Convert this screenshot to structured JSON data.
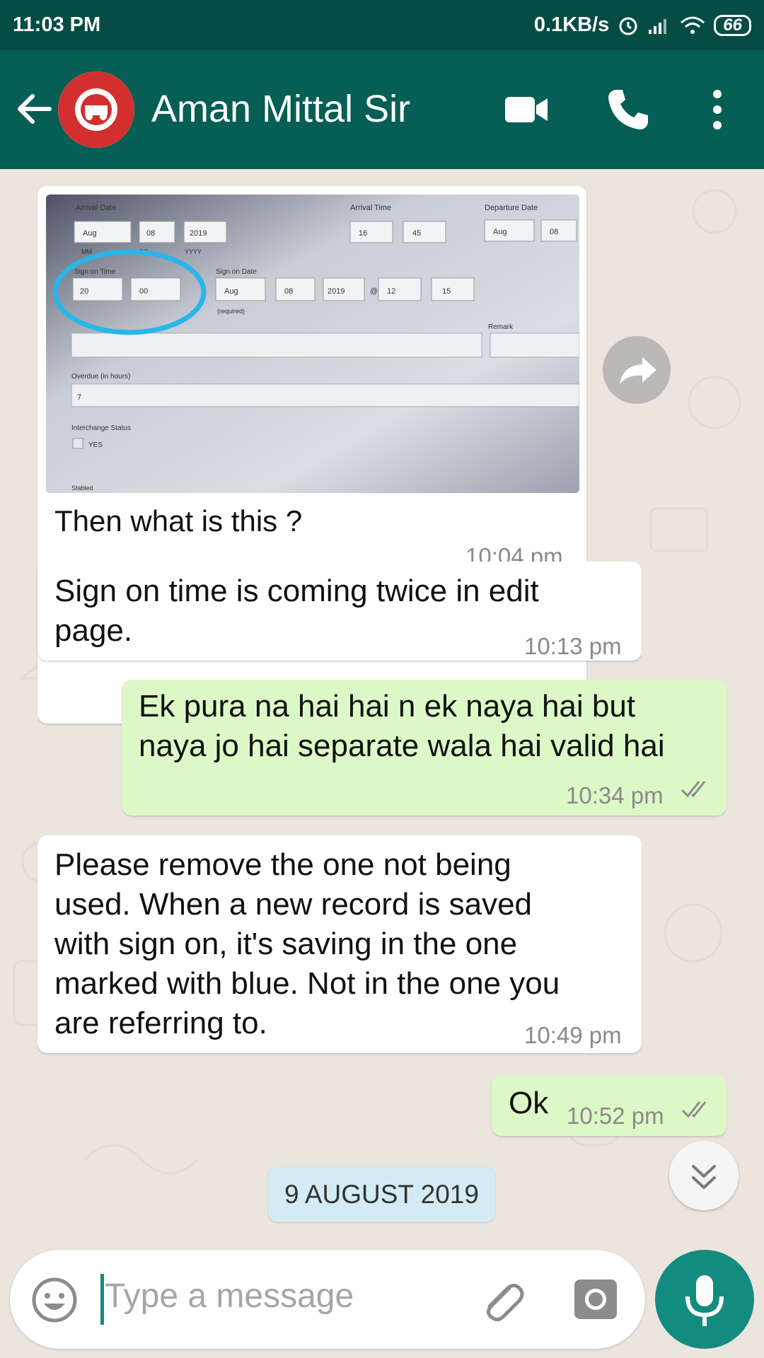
{
  "status_bar": {
    "time": "11:03 PM",
    "net_speed": "0.1KB/s",
    "battery": "66"
  },
  "header": {
    "contact_name": "Aman Mittal Sir",
    "icons": [
      "back-arrow-icon",
      "video-call-icon",
      "phone-icon",
      "more-vert-icon"
    ]
  },
  "messages": [
    {
      "direction": "in",
      "type": "image",
      "caption": "Then what is this ?",
      "time": "10:04 pm"
    },
    {
      "direction": "in",
      "type": "text",
      "lines": [
        "Sign on time is coming twice in edit",
        "page."
      ],
      "time": "10:13 pm"
    },
    {
      "direction": "out",
      "type": "text",
      "lines": [
        "Ek pura na hai hai n ek naya hai but",
        "naya jo hai separate wala hai valid hai"
      ],
      "time": "10:34 pm",
      "status": "read"
    },
    {
      "direction": "in",
      "type": "text",
      "lines": [
        "Please remove the one not being",
        "used. When a new record is saved",
        "with sign on, it's saving in the one",
        "marked with blue. Not in the one you",
        "are referring to."
      ],
      "time": "10:49 pm"
    },
    {
      "direction": "out",
      "type": "text",
      "lines": [
        "Ok"
      ],
      "time": "10:52 pm",
      "status": "read"
    }
  ],
  "screenshot_form": {
    "labels": {
      "arrival_date": "Arrival Date",
      "arrival_time": "Arrival Time",
      "departure_date": "Departure Date",
      "mm": "MM",
      "dd": "DD",
      "yyyy": "YYYY",
      "sign_on_time": "Sign on Time",
      "sign_on_date": "Sign on Date",
      "required": "(required)",
      "remark": "Remark",
      "overdue": "Overdue (in hours)",
      "interchange": "Interchange Status",
      "yes": "YES",
      "stabled": "Stabled"
    },
    "values": {
      "arr_month": "Aug",
      "arr_day": "08",
      "arr_year": "2019",
      "arr_hour": "16",
      "arr_min": "45",
      "dep_month": "Aug",
      "dep_day": "08",
      "sot_hour": "20",
      "sot_min": "00",
      "sod_month": "Aug",
      "sod_day": "08",
      "sod_year": "2019",
      "sod_at": "@",
      "sod_hour": "12",
      "sod_min": "15",
      "overdue": "7"
    },
    "highlight_color": "#29b6e8"
  },
  "date_separator": "9 AUGUST 2019",
  "input": {
    "placeholder": "Type a message"
  },
  "colors": {
    "header": "#075e54",
    "status_bar": "#054d44",
    "outgoing_bubble": "#dcf8c6",
    "incoming_bubble": "#ffffff",
    "accent": "#128c7e",
    "read_ticks": "#8a8a8a"
  }
}
